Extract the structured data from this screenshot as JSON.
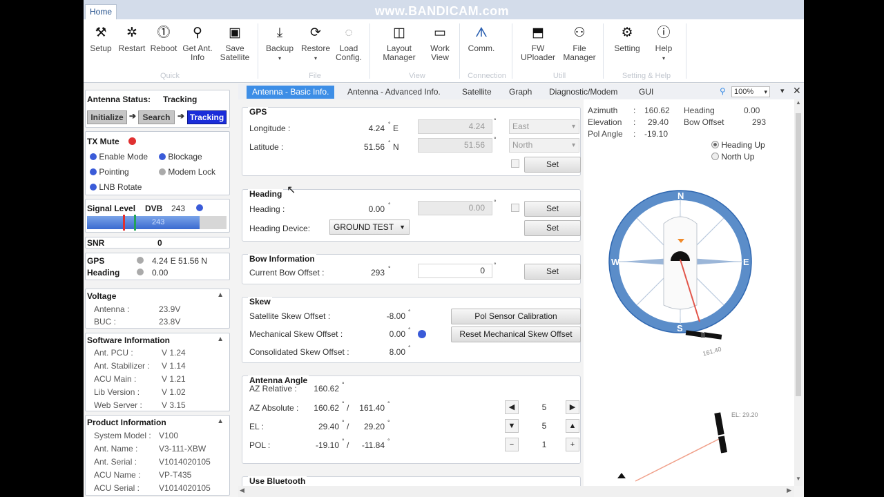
{
  "watermark": "www.BANDICAM.com",
  "ribbon": {
    "tab_home": "Home",
    "buttons": [
      {
        "label": "Setup",
        "icon": "wrench-icon"
      },
      {
        "label": "Restart",
        "icon": "restart-icon"
      },
      {
        "label": "Reboot",
        "icon": "power-icon"
      },
      {
        "label": "Get Ant.\nInfo",
        "icon": "antenna-icon"
      },
      {
        "label": "Save\nSatellite",
        "icon": "save-icon"
      },
      {
        "label": "Backup",
        "icon": "download-icon"
      },
      {
        "label": "Restore",
        "icon": "restore-icon"
      },
      {
        "label": "Load\nConfig.",
        "icon": "load-icon"
      },
      {
        "label": "Layout\nManager",
        "icon": "layout-icon"
      },
      {
        "label": "Work\nView",
        "icon": "window-icon"
      },
      {
        "label": "Comm.",
        "icon": "signal-icon"
      },
      {
        "label": "FW\nUPloader",
        "icon": "firmware-icon"
      },
      {
        "label": "File\nManager",
        "icon": "file-manager-icon"
      },
      {
        "label": "Setting",
        "icon": "gear-icon"
      },
      {
        "label": "Help",
        "icon": "info-icon"
      }
    ],
    "groups": [
      "Quick",
      "File",
      "View",
      "Connection",
      "Utill",
      "Setting & Help"
    ]
  },
  "status": {
    "antenna_status_label": "Antenna Status:",
    "antenna_status_value": "Tracking",
    "steps": [
      "Initialize",
      "Search",
      "Tracking"
    ],
    "tx_mute": "TX Mute",
    "indicators": [
      "Enable Mode",
      "Blockage",
      "Pointing",
      "Modem Lock",
      "LNB Rotate"
    ],
    "signal_level": "Signal Level",
    "signal_mode": "DVB",
    "signal_value": "243",
    "signal_bar_text": "243",
    "snr_label": "SNR",
    "snr_value": "0",
    "gps_label": "GPS",
    "gps_value": "4.24 E  51.56 N",
    "heading_label": "Heading",
    "heading_value": "0.00"
  },
  "voltage": {
    "title": "Voltage",
    "rows": [
      {
        "k": "Antenna :",
        "v": "23.9V"
      },
      {
        "k": "BUC :",
        "v": "23.8V"
      }
    ]
  },
  "software": {
    "title": "Software Information",
    "rows": [
      {
        "k": "Ant. PCU :",
        "v": "V 1.24"
      },
      {
        "k": "Ant. Stabilizer :",
        "v": "V 1.14"
      },
      {
        "k": "ACU Main :",
        "v": "V 1.21"
      },
      {
        "k": "Lib Version :",
        "v": "V 1.02"
      },
      {
        "k": "Web Server :",
        "v": "V 3.15"
      }
    ]
  },
  "product": {
    "title": "Product Information",
    "rows": [
      {
        "k": "System Model :",
        "v": "V100"
      },
      {
        "k": "Ant. Name :",
        "v": "V3-111-XBW"
      },
      {
        "k": "Ant. Serial :",
        "v": "V1014020105"
      },
      {
        "k": "ACU Name :",
        "v": "VP-T435"
      },
      {
        "k": "ACU Serial :",
        "v": "V1014020105"
      }
    ]
  },
  "tabs": [
    "Antenna - Basic Info.",
    "Antenna - Advanced Info.",
    "Satellite",
    "Graph",
    "Diagnostic/Modem",
    "GUI"
  ],
  "zoom": "100%",
  "gps": {
    "title": "GPS",
    "lon_label": "Longitude :",
    "lon_value": "4.24",
    "lon_dir": "E",
    "lon_input": "4.24",
    "lon_select": "East",
    "lat_label": "Latitude :",
    "lat_value": "51.56",
    "lat_dir": "N",
    "lat_input": "51.56",
    "lat_select": "North",
    "set": "Set"
  },
  "heading": {
    "title": "Heading",
    "label": "Heading :",
    "value": "0.00",
    "input": "0.00",
    "set": "Set",
    "device_label": "Heading Device:",
    "device_value": "GROUND TEST",
    "set2": "Set"
  },
  "bow": {
    "title": "Bow Information",
    "label": "Current Bow Offset :",
    "value": "293",
    "input": "0",
    "set": "Set"
  },
  "skew": {
    "title": "Skew",
    "sat_label": "Satellite Skew Offset :",
    "sat_value": "-8.00",
    "mech_label": "Mechanical Skew Offset :",
    "mech_value": "0.00",
    "cons_label": "Consolidated Skew Offset :",
    "cons_value": "8.00",
    "btn_pol": "Pol Sensor Calibration",
    "btn_reset": "Reset Mechanical Skew Offset"
  },
  "angle": {
    "title": "Antenna Angle",
    "az_rel_label": "AZ Relative :",
    "az_rel": "160.62",
    "az_abs_label": "AZ Absolute :",
    "az_abs": "160.62",
    "az_abs2": "161.40",
    "el_label": "EL :",
    "el": "29.40",
    "el2": "29.20",
    "pol_label": "POL :",
    "pol": "-19.10",
    "pol2": "-11.84",
    "step1": "5",
    "step2": "5",
    "step3": "1"
  },
  "bluetooth": {
    "title": "Use Bluetooth"
  },
  "compass": {
    "azimuth_label": "Azimuth",
    "azimuth": "160.62",
    "elevation_label": "Elevation",
    "elevation": "29.40",
    "pol_label": "Pol Angle",
    "pol": "-19.10",
    "heading_label": "Heading",
    "heading": "0.00",
    "bow_label": "Bow Offset",
    "bow": "293",
    "mode_heading_up": "Heading Up",
    "mode_north_up": "North Up",
    "dir_n": "N",
    "dir_s": "S",
    "dir_e": "E",
    "dir_w": "W",
    "sat_az_label": "161.40",
    "el_label": "EL: 29.20"
  }
}
